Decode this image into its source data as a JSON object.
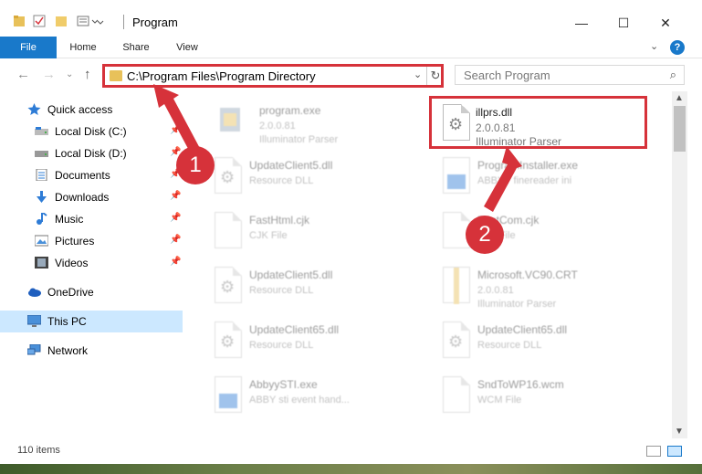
{
  "window": {
    "title": "Program",
    "controls": {
      "minimize": "—",
      "maximize": "☐",
      "close": "✕"
    }
  },
  "ribbon": {
    "tabs": [
      {
        "label": "File"
      },
      {
        "label": "Home"
      },
      {
        "label": "Share"
      },
      {
        "label": "View"
      }
    ],
    "expand_icon": "chevron-down-icon",
    "help": "?"
  },
  "address": {
    "path": "C:\\Program Files\\Program Directory",
    "search_placeholder": "Search Program"
  },
  "sidebar": {
    "items": [
      {
        "label": "Quick access",
        "icon": "star-icon"
      },
      {
        "label": "Local Disk (C:)",
        "icon": "drive-icon"
      },
      {
        "label": "Local Disk (D:)",
        "icon": "drive-icon"
      },
      {
        "label": "Documents",
        "icon": "documents-icon"
      },
      {
        "label": "Downloads",
        "icon": "download-icon"
      },
      {
        "label": "Music",
        "icon": "music-icon"
      },
      {
        "label": "Pictures",
        "icon": "pictures-icon"
      },
      {
        "label": "Videos",
        "icon": "videos-icon"
      },
      {
        "label": "OneDrive",
        "icon": "cloud-icon"
      },
      {
        "label": "This PC",
        "icon": "computer-icon"
      },
      {
        "label": "Network",
        "icon": "network-icon"
      }
    ]
  },
  "files": [
    {
      "name": "program.exe",
      "line1": "2.0.0.81",
      "line2": "Illuminator Parser",
      "icon": "exe-icon"
    },
    {
      "name": "illprs.dll",
      "line1": "2.0.0.81",
      "line2": "Illuminator Parser",
      "icon": "dll-gear-icon"
    },
    {
      "name": "UpdateClient5.dll",
      "line1": "Resource DLL",
      "line2": "",
      "icon": "dll-gear-icon"
    },
    {
      "name": "ProgramInstaller.exe",
      "line1": "ABBYY finereader ini",
      "line2": "",
      "icon": "exe-icon"
    },
    {
      "name": "FastHtml.cjk",
      "line1": "CJK File",
      "line2": "",
      "icon": "file-icon"
    },
    {
      "name": "FontCom.cjk",
      "line1": "CJK File",
      "line2": "",
      "icon": "file-icon"
    },
    {
      "name": "UpdateClient5.dll",
      "line1": "Resource DLL",
      "line2": "",
      "icon": "dll-gear-icon"
    },
    {
      "name": "Microsoft.VC90.CRT",
      "line1": "2.0.0.81",
      "line2": "Illuminator Parser",
      "icon": "zip-icon"
    },
    {
      "name": "UpdateClient65.dll",
      "line1": "Resource DLL",
      "line2": "",
      "icon": "dll-gear-icon"
    },
    {
      "name": "UpdateClient65.dll",
      "line1": "Resource DLL",
      "line2": "",
      "icon": "dll-gear-icon"
    },
    {
      "name": "AbbyySTI.exe",
      "line1": "ABBY sti event hand...",
      "line2": "",
      "icon": "exe-icon"
    },
    {
      "name": "SndToWP16.wcm",
      "line1": "WCM File",
      "line2": "",
      "icon": "file-icon"
    }
  ],
  "annotations": {
    "step1": "1",
    "step2": "2"
  },
  "status": {
    "count": "110 items"
  },
  "colors": {
    "accent": "#1979ca",
    "highlight": "#d6323a",
    "selection": "#cce8ff"
  }
}
